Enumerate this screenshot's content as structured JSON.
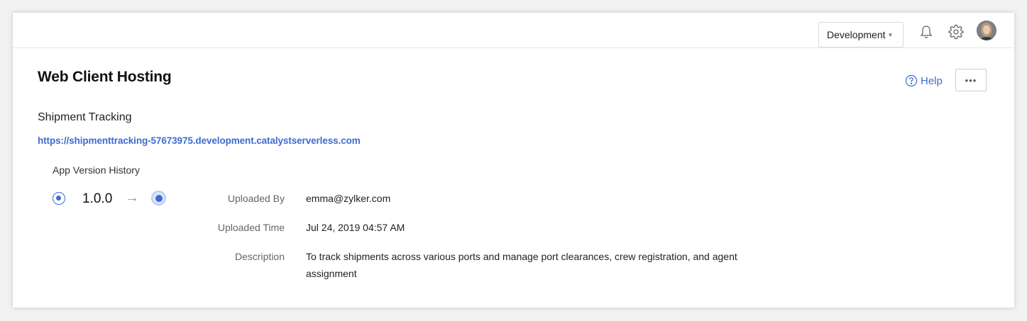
{
  "header": {
    "environment": {
      "selected": "Development"
    },
    "icons": [
      "bell-icon",
      "gear-icon",
      "avatar"
    ]
  },
  "page": {
    "title": "Web Client Hosting",
    "help_label": "Help",
    "more_label": "•••"
  },
  "app": {
    "name": "Shipment Tracking",
    "url": "https://shipmenttracking-57673975.development.catalystserverless.com"
  },
  "history": {
    "label": "App Version History",
    "version": "1.0.0",
    "arrow": "→",
    "details": {
      "uploaded_by_label": "Uploaded By",
      "uploaded_by": "emma@zylker.com",
      "uploaded_time_label": "Uploaded Time",
      "uploaded_time": "Jul 24, 2019 04:57 AM",
      "description_label": "Description",
      "description": "To track shipments across various ports and manage port clearances, crew registration, and agent assignment"
    }
  },
  "colors": {
    "accent": "#3e6bd1",
    "background": "#f2f2f2",
    "card": "#ffffff"
  }
}
